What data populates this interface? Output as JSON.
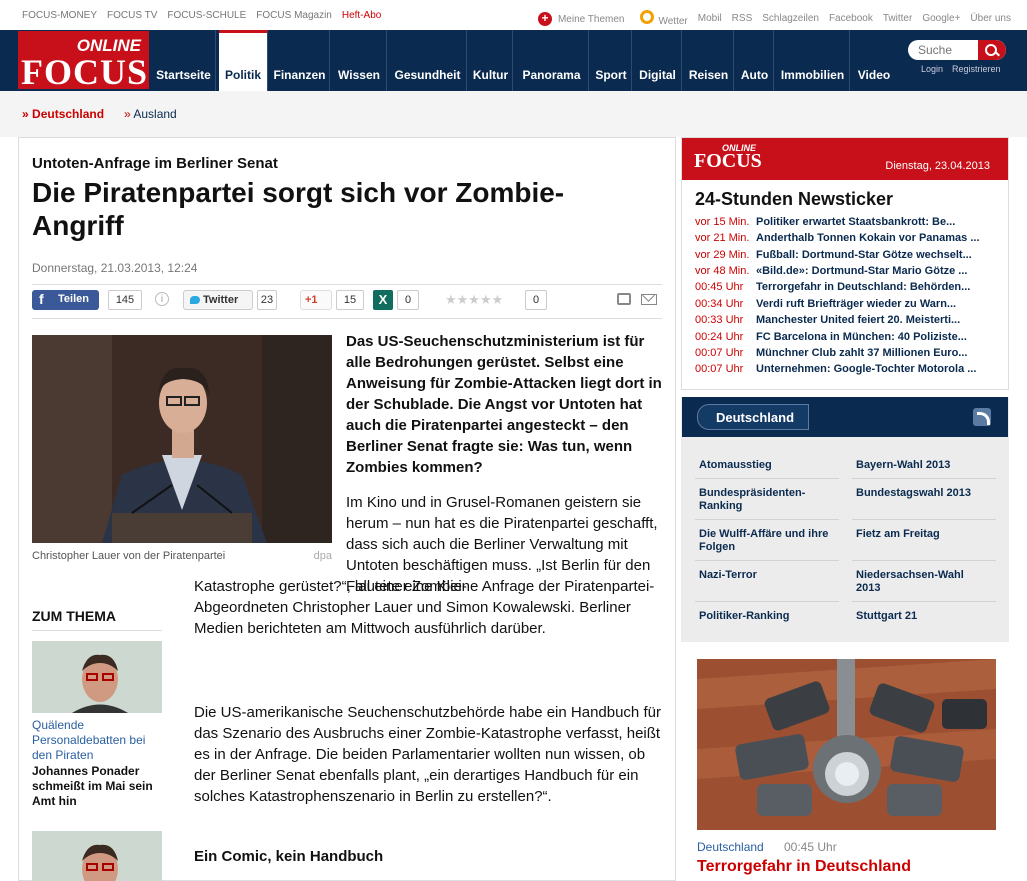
{
  "topbar": {
    "left": [
      "FOCUS-MONEY",
      "FOCUS TV",
      "FOCUS-SCHULE",
      "FOCUS Magazin"
    ],
    "heft": "Heft-Abo",
    "right": [
      "Meine Themen",
      "Wetter",
      "Mobil",
      "RSS",
      "Schlagzeilen",
      "Facebook",
      "Twitter",
      "Google+",
      "Über uns"
    ]
  },
  "logo": {
    "online": "ONLINE",
    "focus": "FOCUS"
  },
  "nav": [
    "Startseite",
    "Politik",
    "Finanzen",
    "Wissen",
    "Gesundheit",
    "Kultur",
    "Panorama",
    "Sport",
    "Digital",
    "Reisen",
    "Auto",
    "Immobilien",
    "Video"
  ],
  "search": {
    "placeholder": "Suche",
    "login": "Login",
    "register": "Registrieren"
  },
  "subnav": [
    {
      "arrow": "»",
      "label": "Deutschland"
    },
    {
      "arrow": "»",
      "label": "Ausland"
    }
  ],
  "article": {
    "kicker": "Untoten-Anfrage im Berliner Senat",
    "headline": "Die Piratenpartei sorgt sich vor Zombie-Angriff",
    "date": "Donnerstag, 21.03.2013, 12:24",
    "share": {
      "fb_label": "Teilen",
      "fb_count": "145",
      "info": "i",
      "tw_label": "Twitter",
      "tw_count": "23",
      "gp_label": "+1",
      "gp_count": "15",
      "xing_label": "X",
      "xing_count": "0",
      "stars": "★★★★★",
      "rating_count": "0"
    },
    "photo_caption": "Christopher Lauer von der Piratenpartei",
    "photo_credit": "dpa",
    "lead": "Das US-Seuchenschutzministerium ist für alle Bedrohungen gerüstet. Selbst eine Anweisung für Zombie-Attacken liegt dort in der Schublade. Die Angst vor Untoten hat auch die Piratenpartei angesteckt – den Berliner Senat fragte sie: Was tun, wenn Zombies kommen?",
    "body1": "Im Kino und in Grusel-Romanen geistern sie herum – nun hat es die Piratenpartei geschafft, dass sich auch die Berliner Verwaltung mit Untoten beschäftigen muss. „Ist Berlin für den Fall einer Zombie-",
    "body2": "Katastrophe gerüstet?“, lautete eine Kleine Anfrage der Piratenpartei-Abgeordneten Christopher Lauer und Simon Kowalewski. Berliner Medien berichteten am Mittwoch ausführlich darüber.",
    "body3": "Die US-amerikanische Seuchenschutzbehörde habe ein Handbuch für das Szenario des Ausbruchs einer Zombie-Katastrophe verfasst, heißt es in der Anfrage. Die beiden Parlamentarier wollten nun wissen, ob der Berliner Senat ebenfalls plant, „ein derartiges Handbuch für ein solches Katastrophenszenario in Berlin zu erstellen?“.",
    "subhead": "Ein Comic, kein Handbuch"
  },
  "zum_thema": {
    "title": "ZUM THEMA",
    "items": [
      {
        "caption": "Quälende Personaldebatten bei den Piraten",
        "title": "Johannes Ponader schmeißt im Mai sein Amt hin"
      }
    ]
  },
  "newsticker": {
    "logo_online": "ONLINE",
    "logo_focus": "FOCUS",
    "date": "Dienstag, 23.04.2013",
    "title": "24-Stunden Newsticker",
    "items": [
      {
        "time": "vor 15 Min.",
        "headline": "Politiker erwartet Staatsbankrott: Be..."
      },
      {
        "time": "vor 21 Min.",
        "headline": "Anderthalb Tonnen Kokain vor Panamas ..."
      },
      {
        "time": "vor 29 Min.",
        "headline": "Fußball: Dortmund-Star Götze wechselt..."
      },
      {
        "time": "vor 48 Min.",
        "headline": "«Bild.de»: Dortmund-Star Mario Götze ..."
      },
      {
        "time": "00:45 Uhr",
        "headline": "Terrorgefahr in Deutschland: Behörden..."
      },
      {
        "time": "00:34 Uhr",
        "headline": "Verdi ruft Briefträger wieder zu Warn..."
      },
      {
        "time": "00:33 Uhr",
        "headline": "Manchester United feiert 20. Meisterti..."
      },
      {
        "time": "00:24 Uhr",
        "headline": "FC Barcelona in München: 40 Polizistе..."
      },
      {
        "time": "00:07 Uhr",
        "headline": "Münchner Club zahlt 37 Millionen Euro..."
      },
      {
        "time": "00:07 Uhr",
        "headline": "Unternehmen: Google-Tochter Motorola ..."
      }
    ]
  },
  "deutschland_box": {
    "tab": "Deutschland",
    "links": [
      [
        "Atomausstieg",
        "Bayern-Wahl 2013"
      ],
      [
        "Bundespräsidenten-Ranking",
        "Bundestagswahl 2013"
      ],
      [
        "Die Wulff-Affäre und ihre Folgen",
        "Fietz am Freitag"
      ],
      [
        "Nazi-Terror",
        "Niedersachsen-Wahl 2013"
      ],
      [
        "Politiker-Ranking",
        "Stuttgart 21"
      ]
    ]
  },
  "teaser": {
    "category": "Deutschland",
    "time": "00:45 Uhr",
    "title": "Terrorgefahr in Deutschland"
  }
}
